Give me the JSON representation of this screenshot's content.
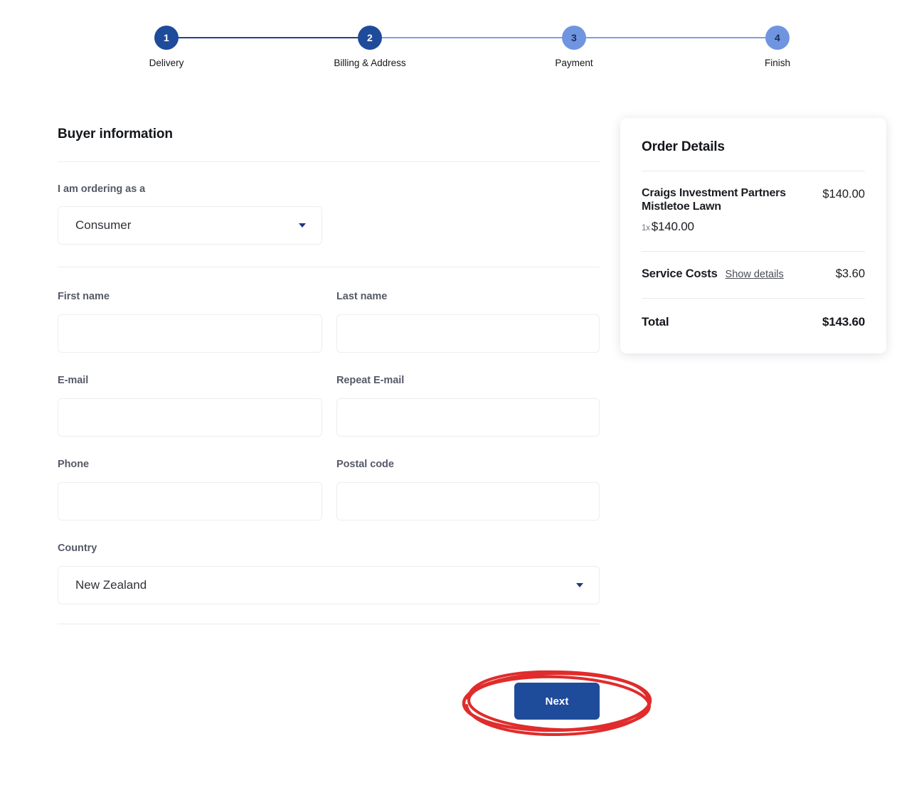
{
  "stepper": {
    "steps": [
      {
        "number": "1",
        "label": "Delivery",
        "state": "active"
      },
      {
        "number": "2",
        "label": "Billing & Address",
        "state": "active"
      },
      {
        "number": "3",
        "label": "Payment",
        "state": "upcoming"
      },
      {
        "number": "4",
        "label": "Finish",
        "state": "upcoming"
      }
    ]
  },
  "form": {
    "title": "Buyer information",
    "ordering_as": {
      "label": "I am ordering as a",
      "value": "Consumer"
    },
    "first_name": {
      "label": "First name",
      "value": "",
      "placeholder": ""
    },
    "last_name": {
      "label": "Last name",
      "value": "",
      "placeholder": ""
    },
    "email": {
      "label": "E-mail",
      "value": "",
      "placeholder": ""
    },
    "repeat_email": {
      "label": "Repeat E-mail",
      "value": "",
      "placeholder": ""
    },
    "phone": {
      "label": "Phone",
      "value": "",
      "placeholder": ""
    },
    "postal_code": {
      "label": "Postal code",
      "value": "",
      "placeholder": ""
    },
    "country": {
      "label": "Country",
      "value": "New Zealand"
    },
    "next_button": "Next"
  },
  "order_details": {
    "title": "Order Details",
    "item": {
      "name": "Craigs Investment Partners Mistletoe Lawn",
      "price": "$140.00",
      "quantity": "1x",
      "unit_price": "$140.00"
    },
    "service_costs": {
      "label": "Service Costs",
      "link": "Show details",
      "amount": "$3.60"
    },
    "total": {
      "label": "Total",
      "amount": "$143.60"
    }
  },
  "colors": {
    "primary_navy": "#1f4b9b",
    "step_upcoming": "#6f95e0",
    "annotation_red": "#e02c2c"
  }
}
